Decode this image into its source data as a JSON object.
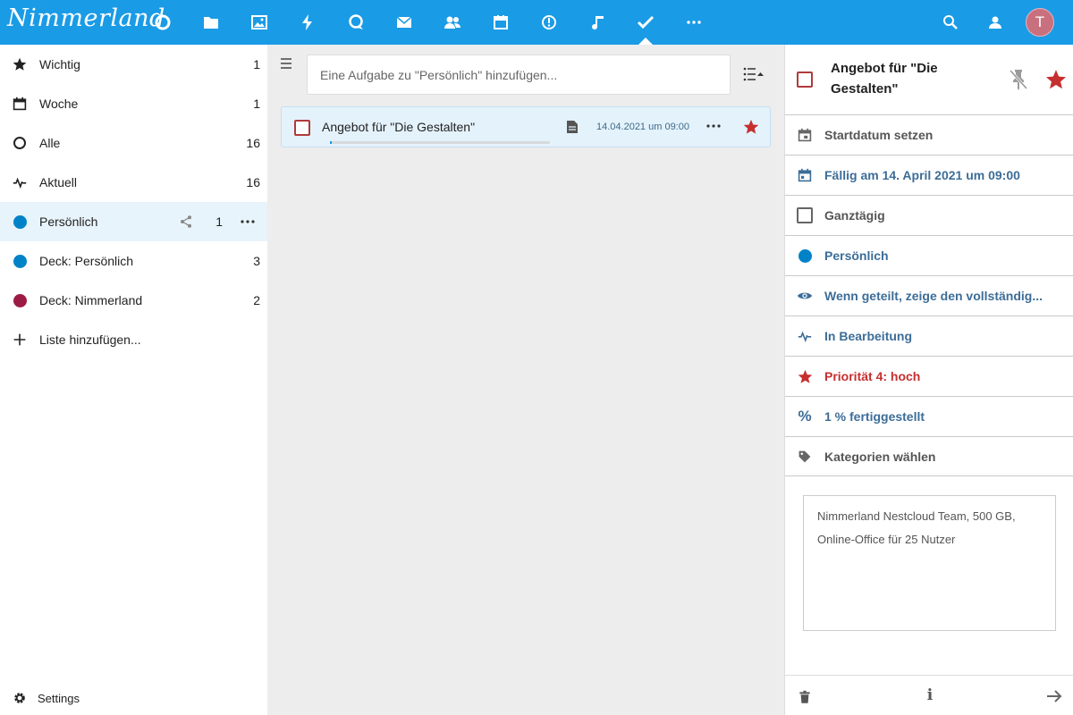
{
  "header": {
    "logo_text": "Nimmerland",
    "apps": [
      "dashboard-icon",
      "files-icon",
      "photos-icon",
      "activity-icon",
      "talk-icon",
      "mail-icon",
      "contacts-icon",
      "calendar-icon",
      "deck-icon",
      "music-icon",
      "tasks-icon",
      "more-apps-icon"
    ],
    "active_app": "tasks-icon",
    "avatar_letter": "T",
    "accent": "#1a9be6"
  },
  "sidebar": {
    "items": [
      {
        "label": "Wichtig",
        "count": "1",
        "icon": "star-icon"
      },
      {
        "label": "Woche",
        "count": "1",
        "icon": "calendar-week-icon"
      },
      {
        "label": "Alle",
        "count": "16",
        "icon": "circle-outline-icon"
      },
      {
        "label": "Aktuell",
        "count": "16",
        "icon": "pulse-icon"
      },
      {
        "label": "Persönlich",
        "count": "1",
        "icon": "list-dot-icon",
        "color": "#0082c9"
      },
      {
        "label": "Deck: Persönlich",
        "count": "3",
        "icon": "list-dot-icon",
        "color": "#0082c9"
      },
      {
        "label": "Deck: Nimmerland",
        "count": "2",
        "icon": "list-dot-icon",
        "color": "#9c1b45"
      },
      {
        "label": "Liste hinzufügen...",
        "count": "",
        "icon": "plus-icon"
      }
    ],
    "settings_label": "Settings"
  },
  "main": {
    "new_task_placeholder": "Eine Aufgabe zu \"Persönlich\" hinzufügen...",
    "tasks": [
      {
        "title": "Angebot für \"Die Gestalten\"",
        "due": "14.04.2021 um 09:00",
        "progress": 0.01,
        "starred": true
      }
    ]
  },
  "details": {
    "title": "Angebot für \"Die Gestalten\"",
    "props": [
      {
        "label": "Startdatum setzen",
        "icon": "calendar-start-icon",
        "style": "grey"
      },
      {
        "label": "Fällig am 14. April 2021 um 09:00",
        "icon": "calendar-due-icon",
        "style": "blue"
      },
      {
        "label": "Ganztägig",
        "icon": "checkbox-icon",
        "style": "grey"
      },
      {
        "label": "Persönlich",
        "icon": "list-dot-icon",
        "style": "blue"
      },
      {
        "label": "Wenn geteilt, zeige den vollständig...",
        "icon": "eye-icon",
        "style": "blue"
      },
      {
        "label": "In Bearbeitung",
        "icon": "pulse-icon",
        "style": "blue"
      },
      {
        "label": "Priorität 4: hoch",
        "icon": "star-icon",
        "style": "red"
      },
      {
        "label": "1 % fertiggestellt",
        "icon": "percent-icon",
        "style": "blue"
      },
      {
        "label": "Kategorien wählen",
        "icon": "tag-icon",
        "style": "grey"
      }
    ],
    "note_line1": "Nimmerland Nestcloud Team, 500 GB,",
    "note_line2": "Online-Office für 25 Nutzer",
    "info_label": "i"
  }
}
